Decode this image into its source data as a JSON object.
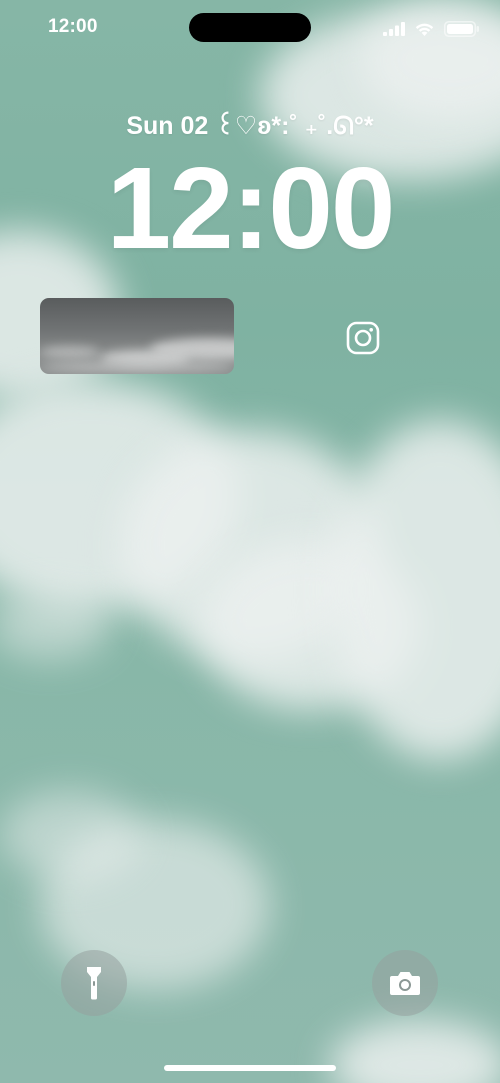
{
  "status_bar": {
    "time": "12:00",
    "icons": [
      "cellular-signal-icon",
      "wifi-icon",
      "battery-icon"
    ]
  },
  "lock_screen": {
    "date_text": "Sun 02 ꒰♡ʚ*:˚ ₊˚.ᘏ°*",
    "clock_text": "12:00"
  },
  "widgets": {
    "photo_widget": "sky-photo",
    "instagram_icon": "instagram-icon"
  },
  "quick_actions": {
    "flashlight_icon": "flashlight-icon",
    "camera_icon": "camera-icon"
  },
  "colors": {
    "wallpaper_teal": "#82b4a4",
    "cloud_white": "#ebf0ee",
    "text_white": "#ffffff"
  }
}
